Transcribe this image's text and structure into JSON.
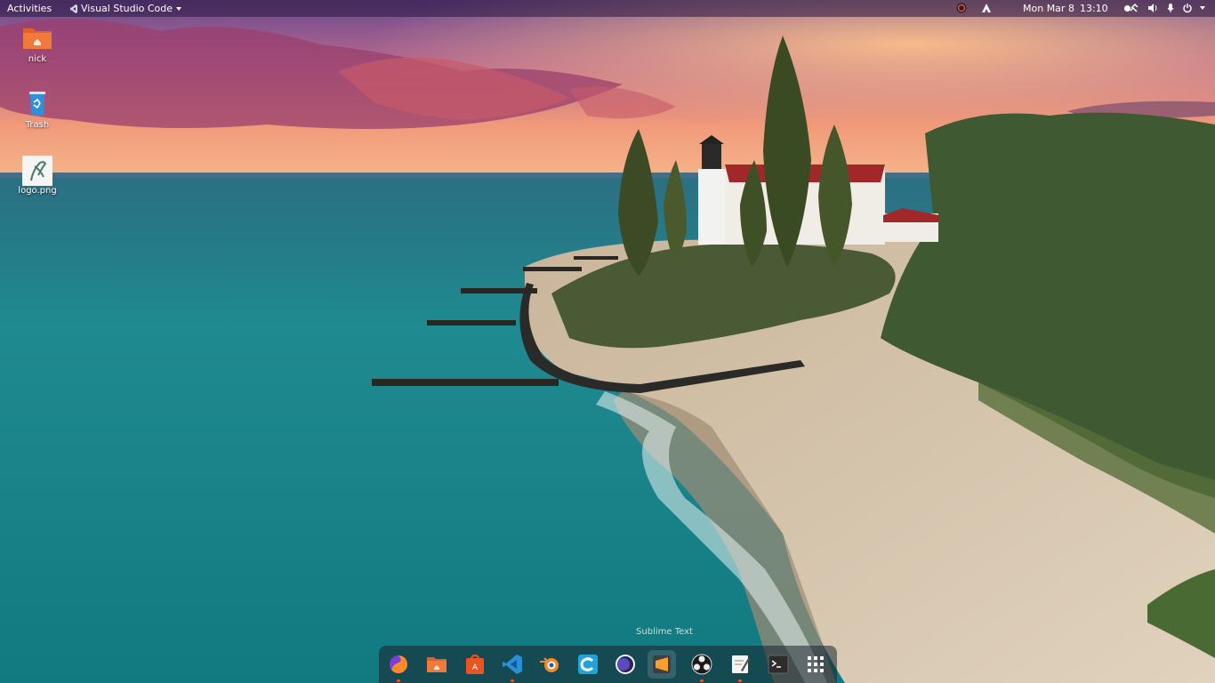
{
  "topbar": {
    "activities": "Activities",
    "app_menu": "Visual Studio Code",
    "date": "Mon Mar 8",
    "time": "13:10"
  },
  "desktop": {
    "icons": [
      {
        "label": "nick",
        "icon": "home-folder-icon"
      },
      {
        "label": "Trash",
        "icon": "trash-icon"
      },
      {
        "label": "logo.png",
        "icon": "image-file-icon"
      }
    ]
  },
  "dock": {
    "tooltip": "Sublime Text",
    "apps": [
      {
        "icon": "firefox-icon"
      },
      {
        "icon": "files-icon"
      },
      {
        "icon": "software-store-icon"
      },
      {
        "icon": "vscode-icon"
      },
      {
        "icon": "blender-icon"
      },
      {
        "icon": "clion-icon"
      },
      {
        "icon": "eclipse-icon"
      },
      {
        "icon": "sublime-text-icon"
      },
      {
        "icon": "obs-icon"
      },
      {
        "icon": "text-editor-icon"
      },
      {
        "icon": "terminal-icon"
      },
      {
        "icon": "show-applications-icon"
      }
    ]
  },
  "colors": {
    "ubuntu_orange": "#e95420",
    "folder_orange": "#f07a3a",
    "trash_blue": "#2f8fd8"
  }
}
